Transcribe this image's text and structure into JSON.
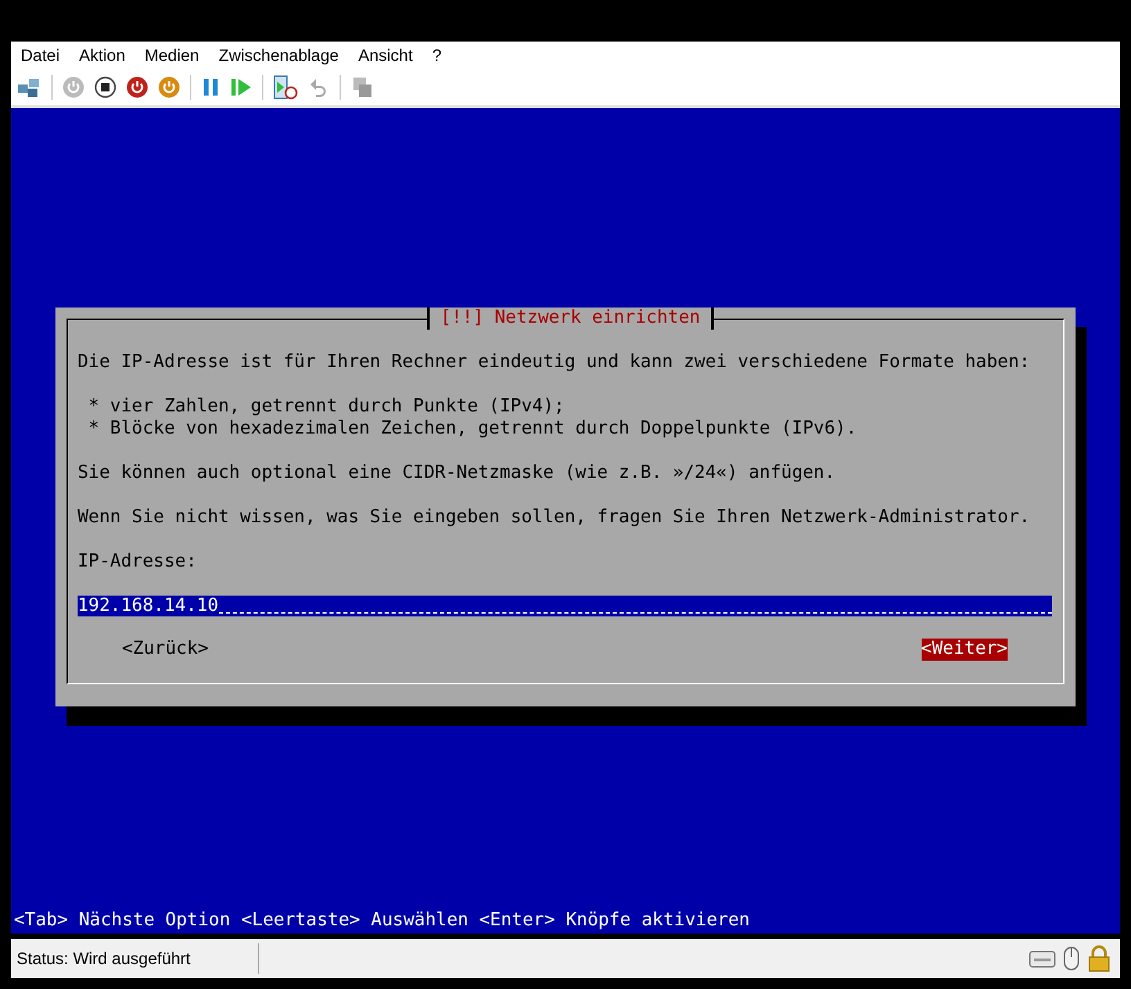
{
  "menu": [
    "Datei",
    "Aktion",
    "Medien",
    "Zwischenablage",
    "Ansicht",
    "?"
  ],
  "dialog": {
    "title": "[!!] Netzwerk einrichten",
    "intro": "Die IP-Adresse ist für Ihren Rechner eindeutig und kann zwei verschiedene Formate haben:",
    "bullets": [
      "* vier Zahlen, getrennt durch Punkte (IPv4);",
      "* Blöcke von hexadezimalen Zeichen, getrennt durch Doppelpunkte (IPv6)."
    ],
    "cidr": "Sie können auch optional eine CIDR-Netzmaske (wie z.B. »/24«) anfügen.",
    "help": "Wenn Sie nicht wissen, was Sie eingeben sollen, fragen Sie Ihren Netzwerk-Administrator.",
    "field_label": "IP-Adresse:",
    "field_value": "192.168.14.10",
    "buttons": [
      {
        "label": "<Zurück>",
        "selected": false
      },
      {
        "label": "<Weiter>",
        "selected": true
      }
    ]
  },
  "hint": "<Tab> Nächste Option <Leertaste> Auswählen <Enter> Knöpfe aktivieren",
  "status_bar": "Status: Wird ausgeführt"
}
